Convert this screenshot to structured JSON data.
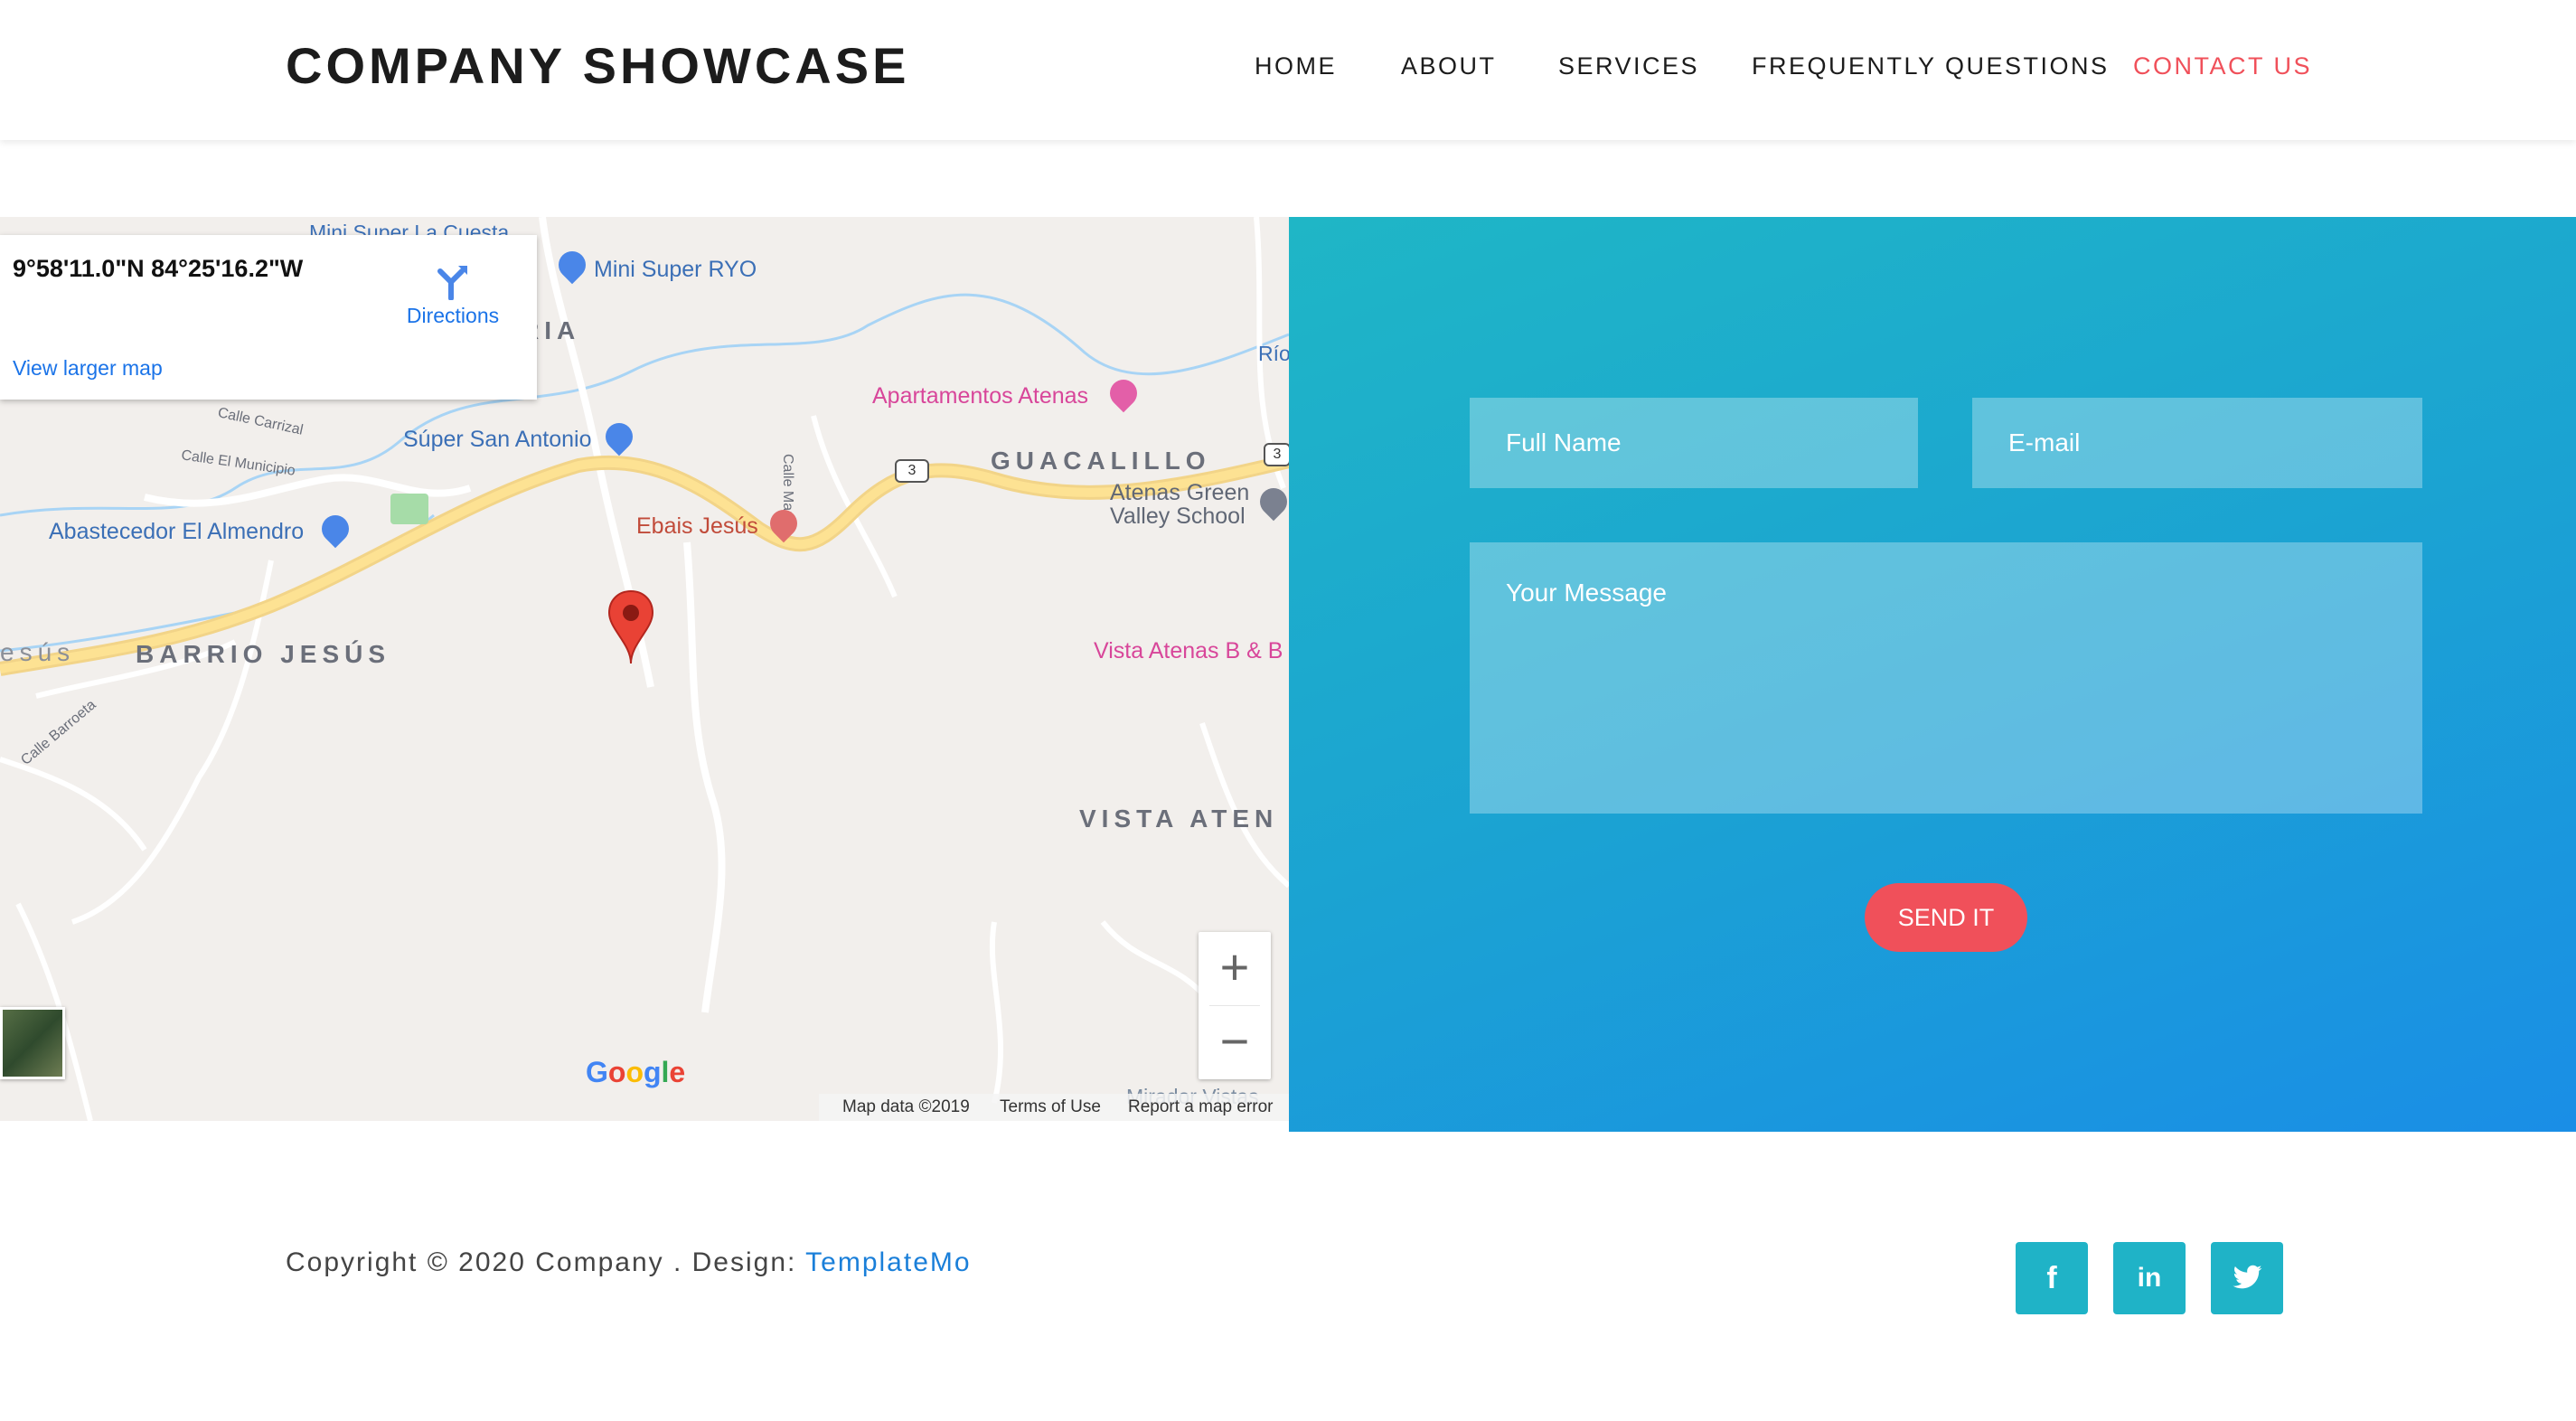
{
  "header": {
    "brand": "COMPANY SHOWCASE",
    "nav": [
      "HOME",
      "ABOUT",
      "SERVICES",
      "FREQUENTLY QUESTIONS",
      "CONTACT US"
    ],
    "active_nav": "CONTACT US"
  },
  "map": {
    "coordinates": "9°58'11.0\"N 84°25'16.2\"W",
    "directions_label": "Directions",
    "view_larger_label": "View larger map",
    "labels": {
      "mini_super_la_cuesta": "Mini Super La Cuesta",
      "mini_super_ryo": "Mini Super RYO",
      "ria": "RIA",
      "rio": "Río",
      "apartamentos_atenas": "Apartamentos Atenas",
      "calle_carrizal": "Calle Carrizal",
      "calle_el_municipio": "Calle El Municipio",
      "super_san_antonio": "Súper San Antonio",
      "calle_marin": "Calle Marin",
      "guacalillo": "GUACALILLO",
      "route_3": "3",
      "atenas_green_valley_school": "Atenas Green Valley School",
      "abastecedor_el_almendro": "Abastecedor El Almendro",
      "ebais_jesus": "Ebais Jesús",
      "jesus_partial": "esús",
      "barrio_jesus": "BARRIO JESÚS",
      "vista_atenas_bb": "Vista Atenas B & B",
      "calle_barroeta": "Calle Barroeta",
      "vista_atenas_area": "VISTA ATEN",
      "mirador_vistas": "Mirador Vistas"
    },
    "zoom_in": "+",
    "zoom_out": "−",
    "google_logo": "Google",
    "map_data": "Map data ©2019",
    "terms": "Terms of Use",
    "report": "Report a map error"
  },
  "form": {
    "full_name_placeholder": "Full Name",
    "email_placeholder": "E-mail",
    "message_placeholder": "Your Message",
    "send_label": "SEND IT"
  },
  "footer": {
    "copyright_text": "Copyright © 2020 Company . Design: ",
    "designer_link": "TemplateMo",
    "social": [
      "f",
      "in",
      "t"
    ]
  },
  "colors": {
    "accent_red": "#f0505a",
    "panel_gradient_start": "#1fb6c6",
    "panel_gradient_end": "#1a8ee6",
    "social_teal": "#1fb3c7",
    "link_blue": "#1a7fd9"
  },
  "icons": {
    "directions": "directions-icon",
    "map_pin": "map-pin-icon",
    "facebook": "facebook-icon",
    "linkedin": "linkedin-icon",
    "twitter": "twitter-icon"
  }
}
